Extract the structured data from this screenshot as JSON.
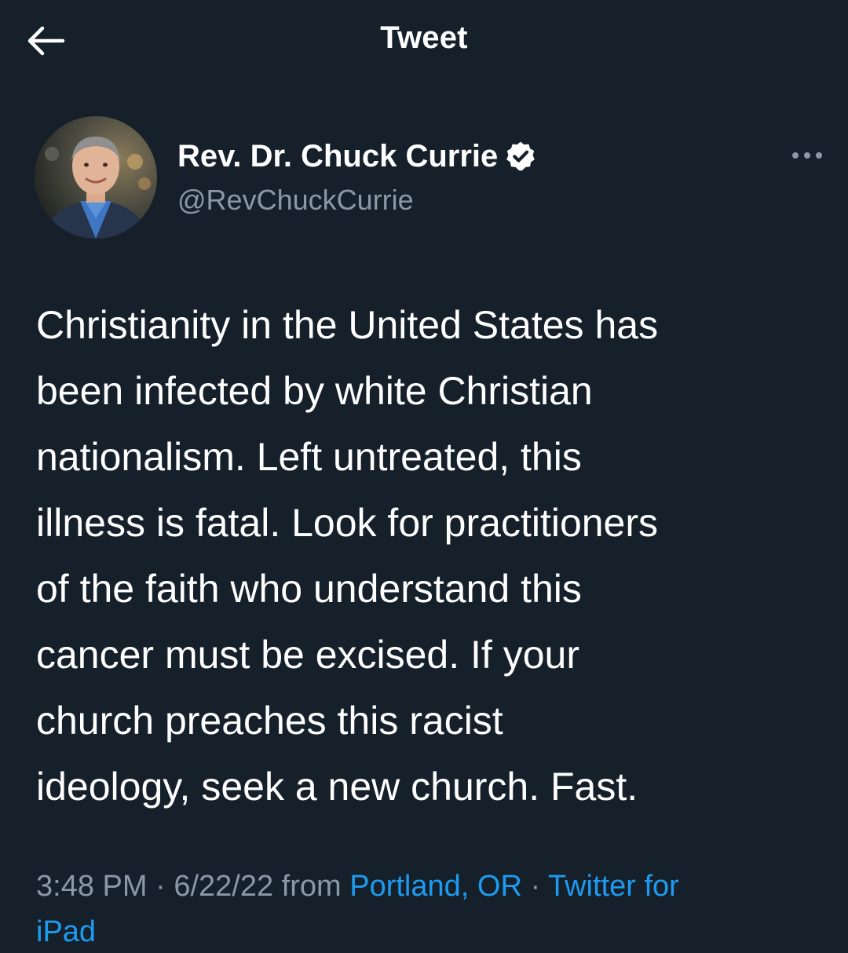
{
  "header": {
    "title": "Tweet",
    "back_icon": "arrow-left-icon"
  },
  "author": {
    "display_name": "Rev. Dr. Chuck Currie",
    "handle": "@RevChuckCurrie",
    "verified": true,
    "verified_color": "#ffffff"
  },
  "tweet": {
    "lines": [
      "Christianity in the United States has",
      "been infected by white Christian",
      "nationalism. Left untreated, this",
      "illness is fatal. Look for practitioners",
      "of the faith who understand this",
      "cancer must be excised. If your",
      "church preaches this racist",
      "ideology, seek a new church. Fast."
    ]
  },
  "meta": {
    "time": "3:48 PM",
    "sep1": " · ",
    "date": "6/22/22",
    "from": " from ",
    "location": "Portland, OR",
    "sep2": " · ",
    "source_part1": "Twitter for",
    "source_part2": "iPad"
  },
  "colors": {
    "background": "#15202b",
    "text": "#ffffff",
    "secondary": "#8b98a5",
    "link": "#1d9bf0"
  }
}
